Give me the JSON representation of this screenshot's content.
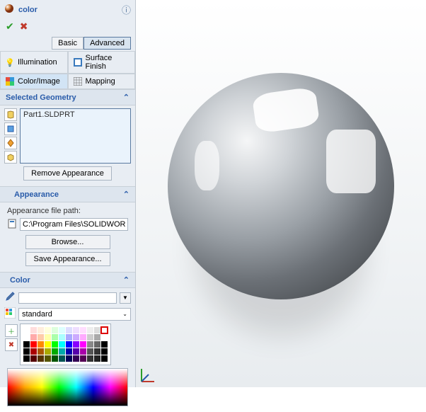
{
  "header": {
    "title": "color"
  },
  "mode": {
    "basic": "Basic",
    "advanced": "Advanced"
  },
  "tabs": {
    "illumination": "Illumination",
    "surface_finish": "Surface Finish",
    "color_image": "Color/Image",
    "mapping": "Mapping"
  },
  "selected_geometry": {
    "heading": "Selected Geometry",
    "item": "Part1.SLDPRT",
    "remove": "Remove Appearance"
  },
  "appearance": {
    "heading": "Appearance",
    "path_label": "Appearance file path:",
    "path_value": "C:\\Program Files\\SOLIDWORKS Co",
    "browse": "Browse...",
    "save": "Save Appearance..."
  },
  "color": {
    "heading": "Color",
    "palette": "standard"
  }
}
